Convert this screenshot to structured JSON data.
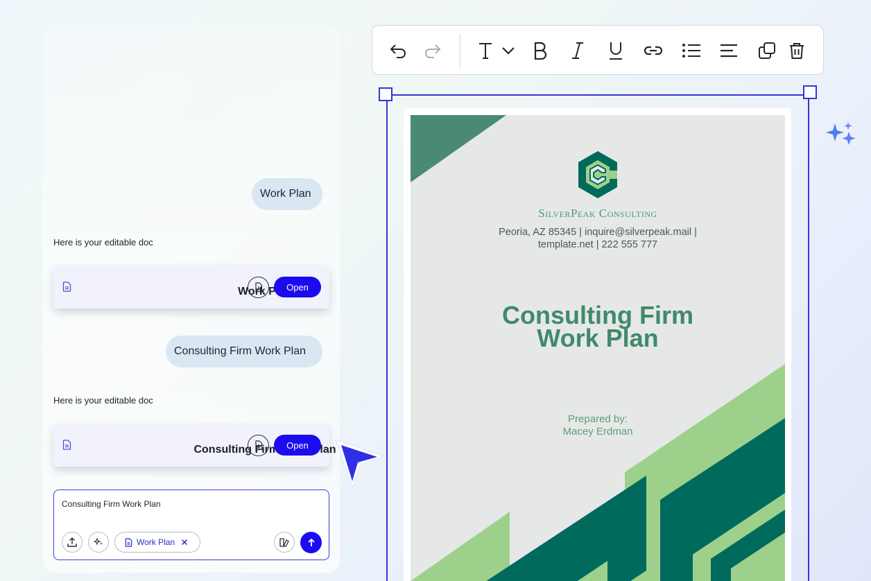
{
  "chat": {
    "messages": [
      {
        "role": "user",
        "text": "Work Plan"
      },
      {
        "role": "assistant",
        "text": "Here is your editable doc"
      },
      {
        "role": "user",
        "text": "Consulting Firm Work Plan"
      },
      {
        "role": "assistant",
        "text": "Here is your editable doc"
      }
    ],
    "doc_cards": [
      {
        "title": "Work Plan",
        "open_label": "Open"
      },
      {
        "title": "Consulting Firm Work Plan",
        "open_label": "Open"
      }
    ],
    "composer": {
      "text": "Consulting Firm Work Plan",
      "attachment_chip": "Work Plan"
    }
  },
  "toolbar": {
    "icons": [
      "undo-icon",
      "redo-icon",
      "text-style-icon",
      "chevron-down-icon",
      "bold-icon",
      "italic-icon",
      "underline-icon",
      "link-icon",
      "bulleted-list-icon",
      "align-left-icon",
      "duplicate-icon",
      "delete-icon"
    ]
  },
  "document": {
    "firm_name": "SilverPeak Consulting",
    "contact_line1": "Peoria, AZ 85345 | inquire@silverpeak.mail |",
    "contact_line2": "template.net | 222 555 777",
    "title_line1": "Consulting Firm",
    "title_line2": "Work Plan",
    "prepared_label": "Prepared by:",
    "prepared_name": "Macey Erdman"
  },
  "colors": {
    "accent": "#1b0cf0",
    "selection": "#3535d6",
    "doc_dark_green": "#006a5c",
    "doc_light_green": "#9dd18b",
    "doc_title_green": "#3f8a6a"
  }
}
